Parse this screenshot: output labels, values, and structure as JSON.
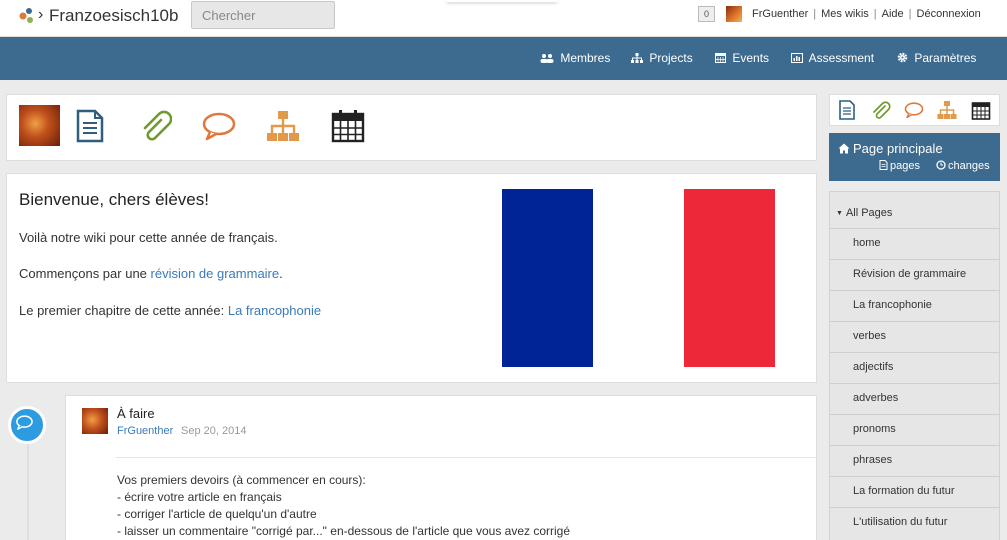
{
  "header": {
    "wiki_title": "Franzoesisch10b",
    "search_placeholder": "Chercher",
    "notification_count": "0",
    "user": "FrGuenther",
    "links": [
      "Mes wikis",
      "Aide",
      "Déconnexion"
    ]
  },
  "nav": {
    "items": [
      {
        "label": "Membres",
        "icon": "users-icon"
      },
      {
        "label": "Projects",
        "icon": "sitemap-icon"
      },
      {
        "label": "Events",
        "icon": "calendar-icon"
      },
      {
        "label": "Assessment",
        "icon": "chart-icon"
      },
      {
        "label": "Paramètres",
        "icon": "gear-icon"
      }
    ]
  },
  "welcome": {
    "title": "Bienvenue, chers élèves!",
    "line1": "Voilà notre wiki pour cette année de français.",
    "line2_prefix": "Commençons par une ",
    "line2_link": "révision de grammaire",
    "line2_suffix": ".",
    "line3_prefix": "Le premier chapitre de cette année: ",
    "line3_link": "La francophonie",
    "flag_colors": [
      "#002395",
      "#ffffff",
      "#ed2939"
    ]
  },
  "activity": {
    "title": "À faire",
    "user": "FrGuenther",
    "date": "Sep 20, 2014",
    "body": [
      "Vos premiers devoirs (à commencer en cours):",
      "- écrire votre article en français",
      "- corriger l'article de quelqu'un d'autre",
      "- laisser un commentaire \"corrigé par...\" en-dessous de l'article que vous avez corrigé"
    ]
  },
  "sidebar": {
    "main_page": "Page principale",
    "pages_link": "pages",
    "changes_link": "changes",
    "all_pages_label": "All Pages",
    "pages": [
      "home",
      "Révision de grammaire",
      "La francophonie",
      "verbes",
      "adjectifs",
      "adverbes",
      "pronoms",
      "phrases",
      "La formation du futur",
      "L'utilisation du futur"
    ]
  },
  "colors": {
    "nav_bg": "#3d6b8f",
    "link": "#3a7ab8",
    "icon_dark": "#2f5f7f",
    "icon_green": "#6f9a2e",
    "icon_orange": "#e0783c",
    "icon_tan": "#e09a4a"
  }
}
